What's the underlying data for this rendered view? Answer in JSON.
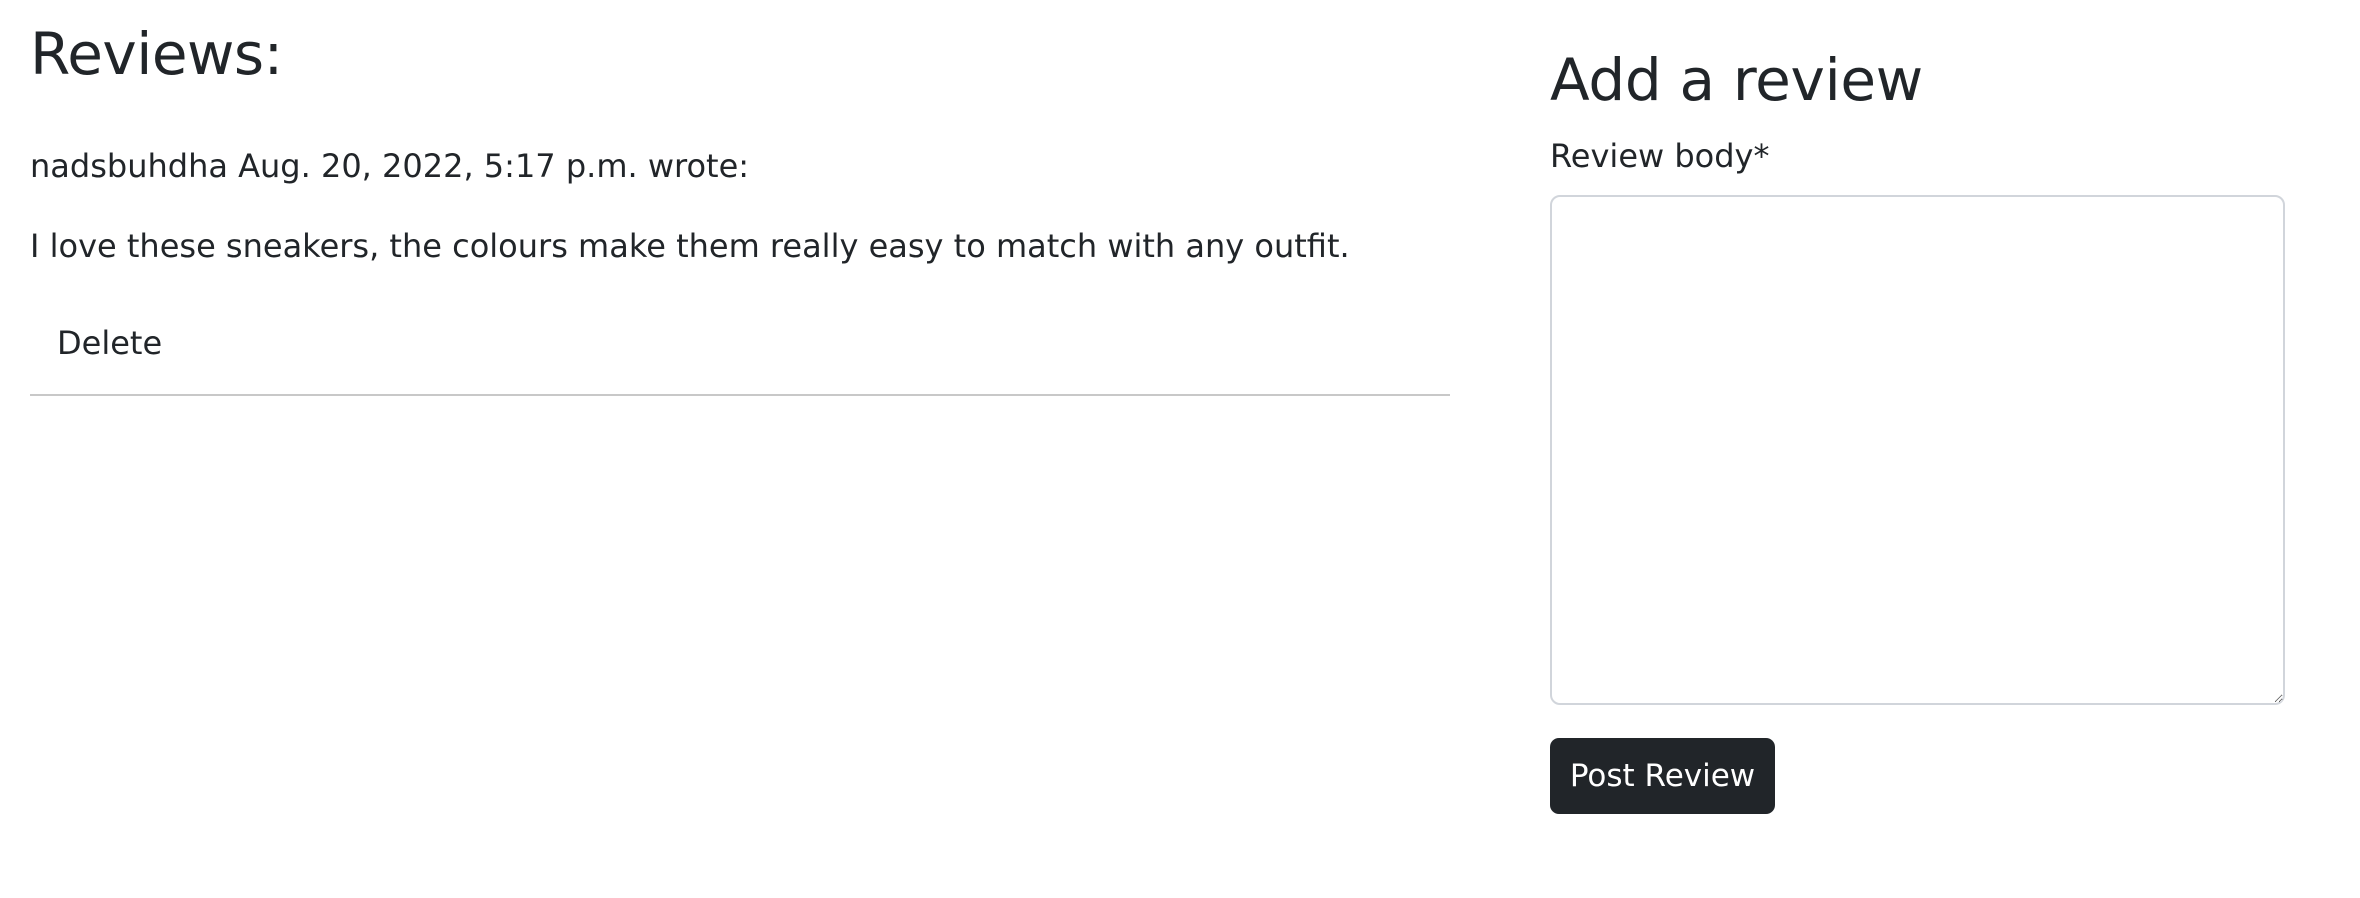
{
  "reviews_section": {
    "heading": "Reviews:",
    "reviews": [
      {
        "meta": "nadsbuhdha Aug. 20, 2022, 5:17 p.m. wrote:",
        "body": "I love these sneakers, the colours make them really easy to match with any outfit.",
        "delete_label": "Delete"
      }
    ]
  },
  "add_review": {
    "heading": "Add a review",
    "field_label": "Review body*",
    "textarea_value": "",
    "submit_label": "Post Review"
  },
  "colors": {
    "text": "#212529",
    "button_bg": "#212529",
    "button_text": "#ffffff",
    "divider": "#c8c8c8",
    "input_border": "#d1d5db"
  }
}
